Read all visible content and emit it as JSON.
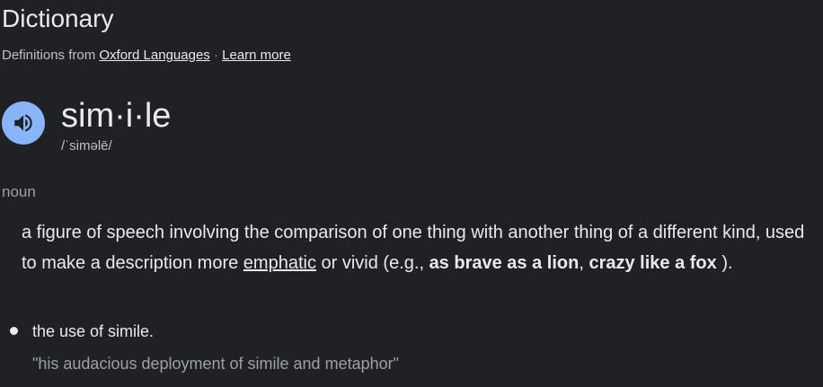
{
  "header": {
    "title": "Dictionary",
    "source_prefix": "Definitions from",
    "source_link": "Oxford Languages",
    "separator": "·",
    "learn_more": "Learn more"
  },
  "entry": {
    "audio_icon": "speaker-icon",
    "headword": "sim·i·le",
    "phonetic": "/ˈsiməlē/",
    "part_of_speech": "noun",
    "definition": {
      "text_before": "a figure of speech involving the comparison of one thing with another thing of a different kind, used to make a description more",
      "link_word": "emphatic",
      "text_middle": "or vivid (e.g.,",
      "example_1": "as brave as a lion",
      "comma": ",",
      "example_2": "crazy like a fox",
      "text_after": ")."
    },
    "sub_sense": {
      "text": "the use of simile.",
      "example": "\"his audacious deployment of simile and metaphor\""
    }
  },
  "colors": {
    "background": "#202124",
    "text_primary": "#e8eaed",
    "text_secondary": "#bdc1c6",
    "text_muted": "#9aa0a6",
    "accent": "#8ab4f8"
  }
}
